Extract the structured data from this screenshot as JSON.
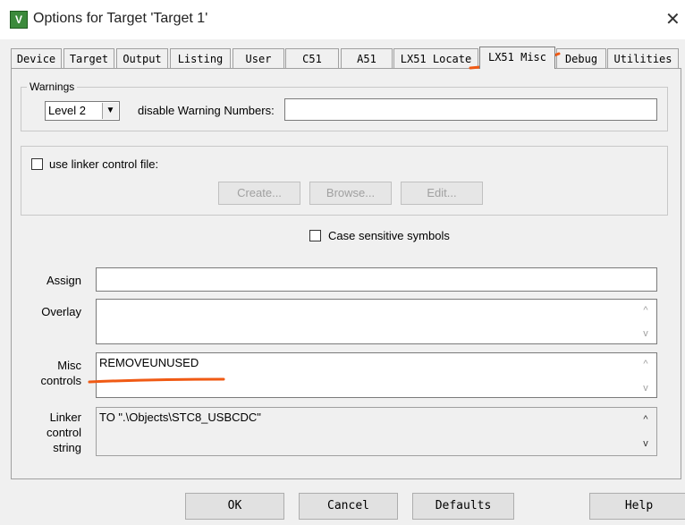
{
  "window": {
    "title": "Options for Target 'Target 1'",
    "close_glyph": "✕",
    "icon_letter": "V"
  },
  "tabs": [
    {
      "label": "Device"
    },
    {
      "label": "Target"
    },
    {
      "label": "Output"
    },
    {
      "label": "Listing"
    },
    {
      "label": "User"
    },
    {
      "label": "C51"
    },
    {
      "label": "A51"
    },
    {
      "label": "LX51 Locate"
    },
    {
      "label": "LX51 Misc"
    },
    {
      "label": "Debug"
    },
    {
      "label": "Utilities"
    }
  ],
  "active_tab": "LX51 Misc",
  "warnings": {
    "legend": "Warnings",
    "level_value": "Level 2",
    "disable_label": "disable Warning Numbers:",
    "disable_value": ""
  },
  "linker_file": {
    "checkbox_label": "use linker control file:",
    "checked": false,
    "create_label": "Create...",
    "browse_label": "Browse...",
    "edit_label": "Edit..."
  },
  "case_sensitive": {
    "label": "Case sensitive symbols",
    "checked": false
  },
  "fields": {
    "assign_label": "Assign",
    "assign_value": "",
    "overlay_label": "Overlay",
    "overlay_value": "",
    "misc_label_1": "Misc",
    "misc_label_2": "controls",
    "misc_value": "REMOVEUNUSED",
    "linker_label_1": "Linker",
    "linker_label_2": "control",
    "linker_label_3": "string",
    "linker_value": "TO \".\\Objects\\STC8_USBCDC\""
  },
  "buttons": {
    "ok": "OK",
    "cancel": "Cancel",
    "defaults": "Defaults",
    "help": "Help"
  },
  "icons": {
    "dropdown": "▼",
    "scroll_up": "^",
    "scroll_down": "v"
  },
  "colors": {
    "annotation": "#f05a14",
    "dialog_bg": "#f0f0f0"
  }
}
